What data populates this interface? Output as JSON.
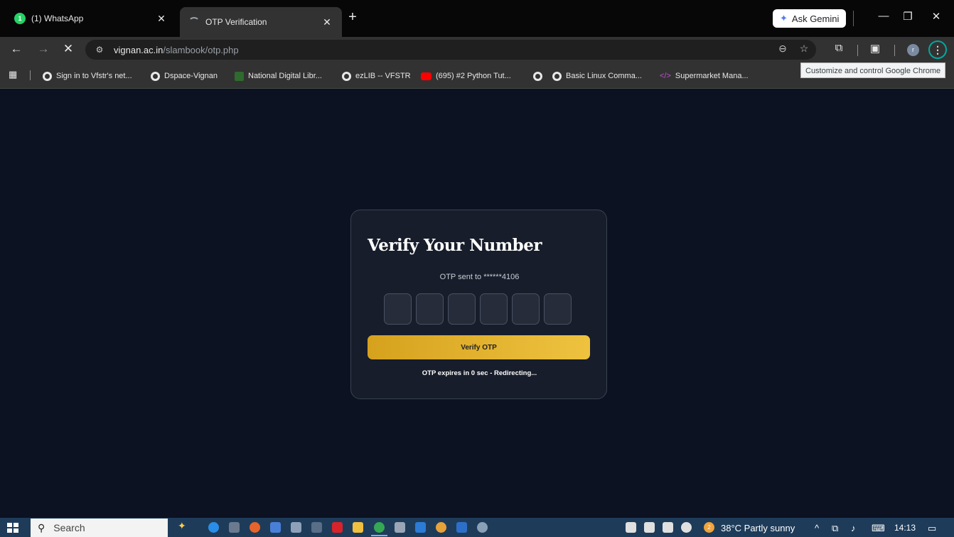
{
  "browser": {
    "tabs": [
      {
        "title": "(1) WhatsApp",
        "badge": "1",
        "active": false
      },
      {
        "title": "OTP Verification",
        "active": true
      }
    ],
    "new_tab_symbol": "+",
    "gemini_label": "Ask Gemini",
    "toolbar": {
      "url_domain": "vignan.ac.in",
      "url_path": "/slambook/otp.php",
      "profile_initial": "r"
    },
    "tooltip": "Customize and control Google Chrome",
    "bookmarks": [
      {
        "label": "Sign in to Vfstr's net...",
        "icon": "globe-icon"
      },
      {
        "label": "Dspace-Vignan",
        "icon": "globe-icon"
      },
      {
        "label": "National Digital Libr...",
        "icon": "ndl-icon"
      },
      {
        "label": "ezLIB -- VFSTR",
        "icon": "globe-icon"
      },
      {
        "label": "(695) #2 Python Tut...",
        "icon": "youtube-icon"
      },
      {
        "label": "",
        "icon": "globe-icon"
      },
      {
        "label": "Basic Linux Comma...",
        "icon": "globe-icon"
      },
      {
        "label": "Supermarket Mana...",
        "icon": "code-icon"
      }
    ]
  },
  "otp_card": {
    "title": "Verify Your Number",
    "sent_to": "OTP sent to ******4106",
    "digit_count": 6,
    "verify_button": "Verify OTP",
    "expiry_message": "OTP expires in 0 sec - Redirecting..."
  },
  "taskbar": {
    "search_label": "Search",
    "weather": "38°C  Partly sunny",
    "time": "14:13",
    "weather_badge": "2"
  },
  "colors": {
    "page_background": "#0c1222",
    "card_background": "#171d2a",
    "button_gradient_start": "#d6a21e",
    "button_gradient_end": "#eec23f",
    "accent_ring": "#00a99d"
  }
}
